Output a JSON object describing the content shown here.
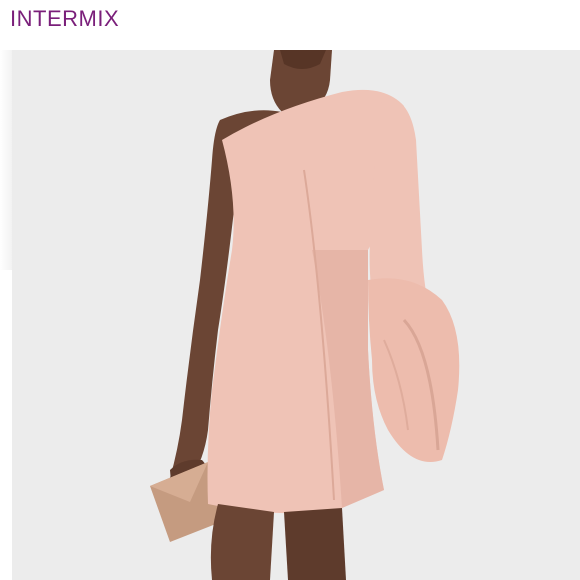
{
  "header": {
    "brand": "INTERMIX"
  },
  "colors": {
    "brand_text": "#7a1f7a",
    "background": "#ececec",
    "dress": "#efc3b6",
    "skin": "#6b4534",
    "clutch": "#c59b80"
  },
  "photo": {
    "subject": "model-wearing-one-shoulder-bell-sleeve-dress"
  }
}
